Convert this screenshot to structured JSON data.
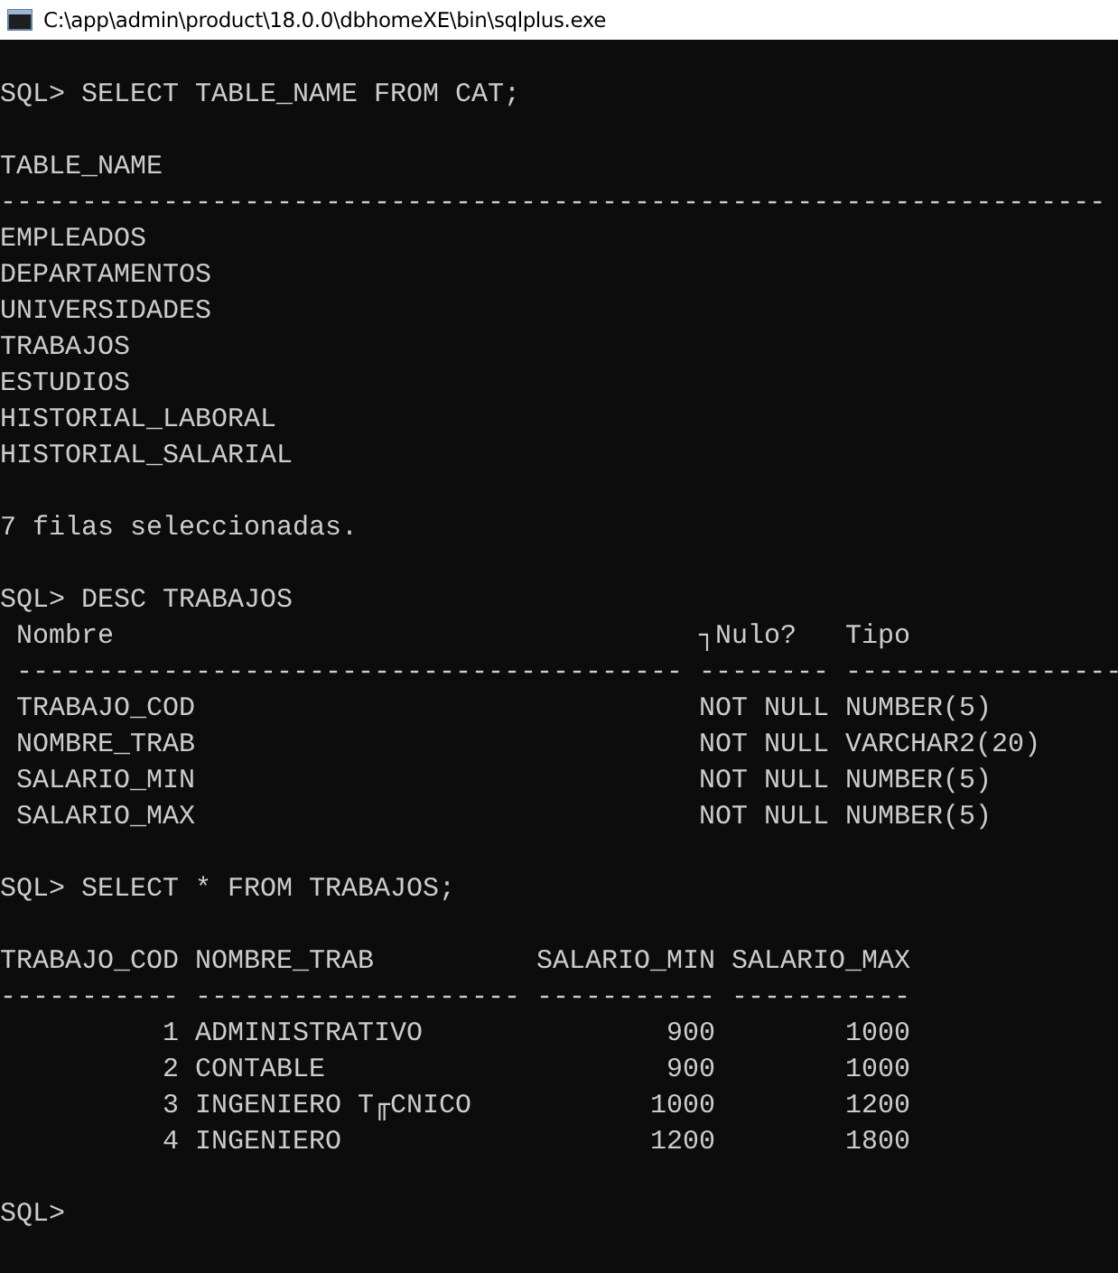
{
  "window": {
    "title": "C:\\app\\admin\\product\\18.0.0\\dbhomeXE\\bin\\sqlplus.exe"
  },
  "console": [
    {
      "kind": "command",
      "prompt": "SQL>",
      "text": "SELECT TABLE_NAME FROM CAT;"
    },
    {
      "kind": "blank"
    },
    {
      "kind": "query_table",
      "columns": [
        {
          "header": "TABLE_NAME",
          "rule": "--------------------------------------------------------------------",
          "kind": "text"
        }
      ],
      "rows": [
        [
          "EMPLEADOS"
        ],
        [
          "DEPARTAMENTOS"
        ],
        [
          "UNIVERSIDADES"
        ],
        [
          "TRABAJOS"
        ],
        [
          "ESTUDIOS"
        ],
        [
          "HISTORIAL_LABORAL"
        ],
        [
          "HISTORIAL_SALARIAL"
        ]
      ]
    },
    {
      "kind": "blank"
    },
    {
      "kind": "message",
      "text": "7 filas seleccionadas."
    },
    {
      "kind": "blank"
    },
    {
      "kind": "command",
      "prompt": "SQL>",
      "text": "DESC TRABAJOS"
    },
    {
      "kind": "describe_table",
      "columns": [
        {
          "header": "Nombre",
          "rule": "-----------------------------------------",
          "kind": "text"
        },
        {
          "header": "┐Nulo?",
          "rule": "--------",
          "kind": "text"
        },
        {
          "header": "Tipo",
          "rule": "-----------------",
          "kind": "text"
        }
      ],
      "rows": [
        [
          "TRABAJO_COD",
          "NOT NULL",
          "NUMBER(5)"
        ],
        [
          "NOMBRE_TRAB",
          "NOT NULL",
          "VARCHAR2(20)"
        ],
        [
          "SALARIO_MIN",
          "NOT NULL",
          "NUMBER(5)"
        ],
        [
          "SALARIO_MAX",
          "NOT NULL",
          "NUMBER(5)"
        ]
      ]
    },
    {
      "kind": "blank"
    },
    {
      "kind": "command",
      "prompt": "SQL>",
      "text": "SELECT * FROM TRABAJOS;"
    },
    {
      "kind": "blank"
    },
    {
      "kind": "query_table",
      "columns": [
        {
          "header": "TRABAJO_COD",
          "rule": "-----------",
          "kind": "number"
        },
        {
          "header": "NOMBRE_TRAB",
          "rule": "--------------------",
          "kind": "text"
        },
        {
          "header": "SALARIO_MIN",
          "rule": "-----------",
          "kind": "number"
        },
        {
          "header": "SALARIO_MAX",
          "rule": "-----------",
          "kind": "number"
        }
      ],
      "rows": [
        [
          "1",
          "ADMINISTRATIVO",
          "900",
          "1000"
        ],
        [
          "2",
          "CONTABLE",
          "900",
          "1000"
        ],
        [
          "3",
          "INGENIERO T╓CNICO",
          "1000",
          "1200"
        ],
        [
          "4",
          "INGENIERO",
          "1200",
          "1800"
        ]
      ]
    },
    {
      "kind": "blank"
    },
    {
      "kind": "command",
      "prompt": "SQL>"
    }
  ]
}
